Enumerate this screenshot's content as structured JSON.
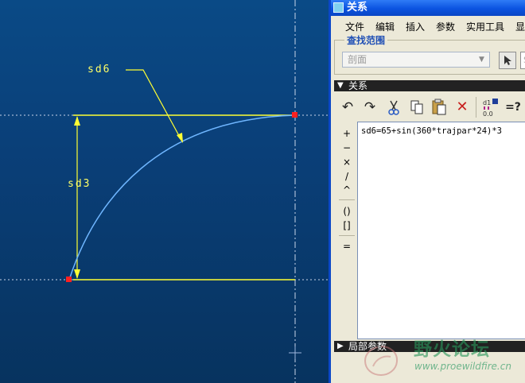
{
  "canvas": {
    "dimensions": [
      "sd6",
      "sd3"
    ],
    "colors": {
      "background": "#0a4a86",
      "dimension": "#ffff33",
      "curve": "#6fb6ff",
      "point": "#ff2020",
      "centerline": "#c8d4e8"
    }
  },
  "dialog": {
    "title": "关系",
    "menu": [
      "文件",
      "编辑",
      "插入",
      "参数",
      "实用工具",
      "显"
    ],
    "search_scope": {
      "legend": "查找范围",
      "selected": "剖面",
      "field_hint": "S"
    },
    "relations_section": "关系",
    "toolbar_icons": [
      "undo-icon",
      "redo-icon",
      "cut-icon",
      "copy-icon",
      "paste-icon",
      "delete-icon",
      "switch-dimensions-icon",
      "evaluate-icon"
    ],
    "evaluate_label": "=?",
    "operators": [
      "+",
      "−",
      "×",
      "/",
      "^",
      "()",
      "[]",
      "="
    ],
    "relation_text": "sd6=65+sin(360*trajpar*24)*3",
    "local_params_section": "局部参数"
  },
  "watermark": {
    "site_name": "野火论坛",
    "url": "www.proewildfire.cn"
  }
}
